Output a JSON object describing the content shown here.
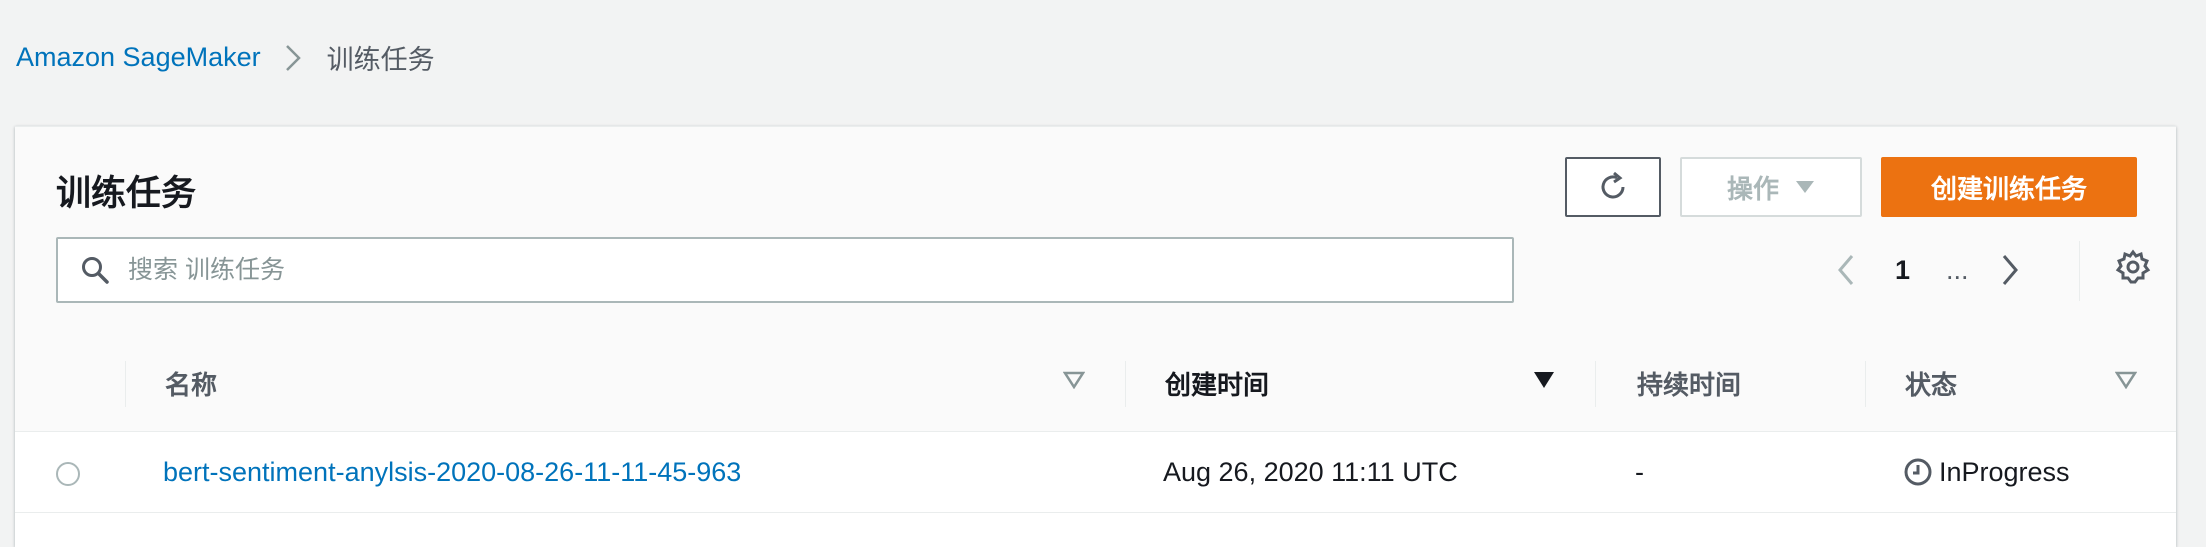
{
  "breadcrumb": {
    "root": "Amazon SageMaker",
    "current": "训练任务"
  },
  "header": {
    "title": "训练任务",
    "actions_label": "操作",
    "create_label": "创建训练任务"
  },
  "search": {
    "placeholder": "搜索 训练任务",
    "value": ""
  },
  "pagination": {
    "current_page": "1",
    "ellipsis": "..."
  },
  "table": {
    "columns": [
      "名称",
      "创建时间",
      "持续时间",
      "状态"
    ],
    "rows": [
      {
        "name": "bert-sentiment-anylsis-2020-08-26-11-11-45-963",
        "created": "Aug 26, 2020 11:11 UTC",
        "duration": "-",
        "status": "InProgress"
      }
    ]
  },
  "colors": {
    "link": "#0073bb",
    "primary_button": "#ec7211",
    "background": "#f2f3f3"
  },
  "icons": [
    "chevron-right-icon",
    "refresh-icon",
    "caret-down-icon",
    "search-icon",
    "chevron-left-icon",
    "gear-icon",
    "sort-caret-outline-icon",
    "sort-caret-filled-icon",
    "clock-icon"
  ]
}
